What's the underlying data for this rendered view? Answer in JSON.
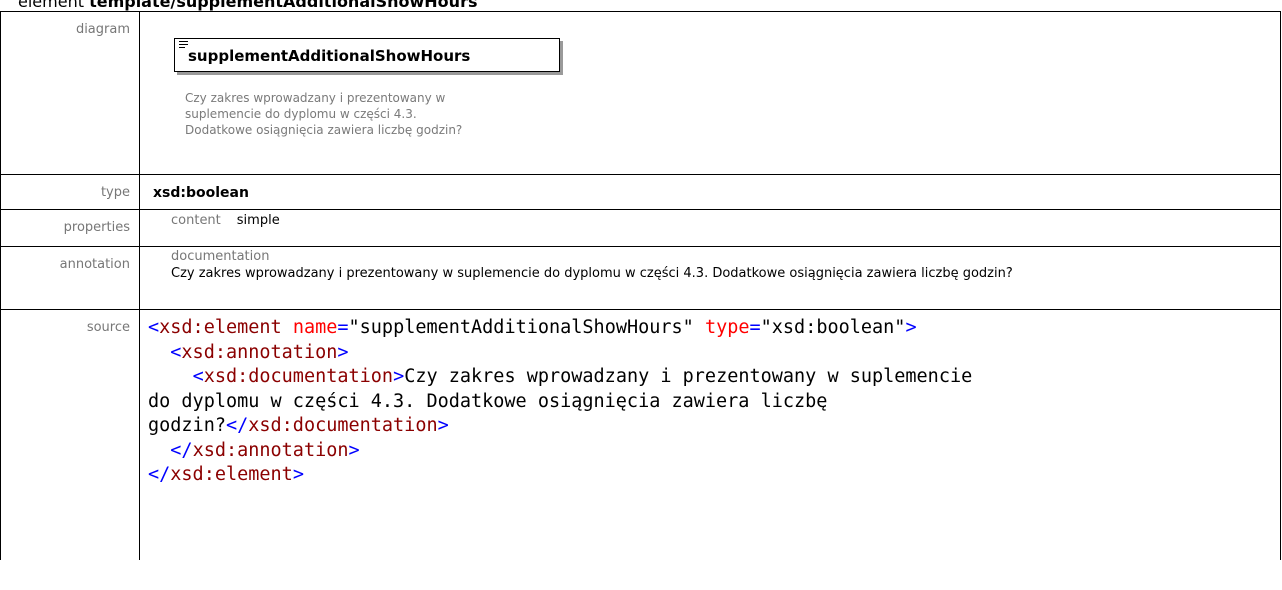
{
  "heading": {
    "prefix": "element ",
    "path": "template/supplementAdditionalShowHours"
  },
  "rows": {
    "diagram": {
      "label": "diagram",
      "box_title": "supplementAdditionalShowHours",
      "doc_lines": [
        "Czy zakres wprowadzany i prezentowany w",
        "suplemencie do dyplomu w części 4.3.",
        "Dodatkowe osiągnięcia zawiera liczbę godzin?"
      ]
    },
    "type": {
      "label": "type",
      "value": "xsd:boolean"
    },
    "properties": {
      "label": "properties",
      "key": "content",
      "value": "simple"
    },
    "annotation": {
      "label": "annotation",
      "key": "documentation",
      "value": "Czy zakres wprowadzany i prezentowany w suplemencie do dyplomu w części 4.3. Dodatkowe osiągnięcia zawiera liczbę godzin?"
    },
    "source": {
      "label": "source",
      "element_open": "xsd:element",
      "attr_name": "name",
      "attr_name_value": "\"supplementAdditionalShowHours\"",
      "attr_type": "type",
      "attr_type_value": "\"xsd:boolean\"",
      "annotation_tag": "xsd:annotation",
      "documentation_tag": "xsd:documentation",
      "documentation_text_1": "Czy zakres wprowadzany i prezentowany w suplemencie",
      "documentation_text_2": "do dyplomu w części 4.3. Dodatkowe osiągnięcia zawiera liczbę",
      "documentation_text_3": "godzin?",
      "element_close": "xsd:element"
    }
  },
  "colors": {
    "tag": "#8b0000",
    "punct": "#0000ff",
    "attr": "#ff0000",
    "label": "#777777"
  }
}
